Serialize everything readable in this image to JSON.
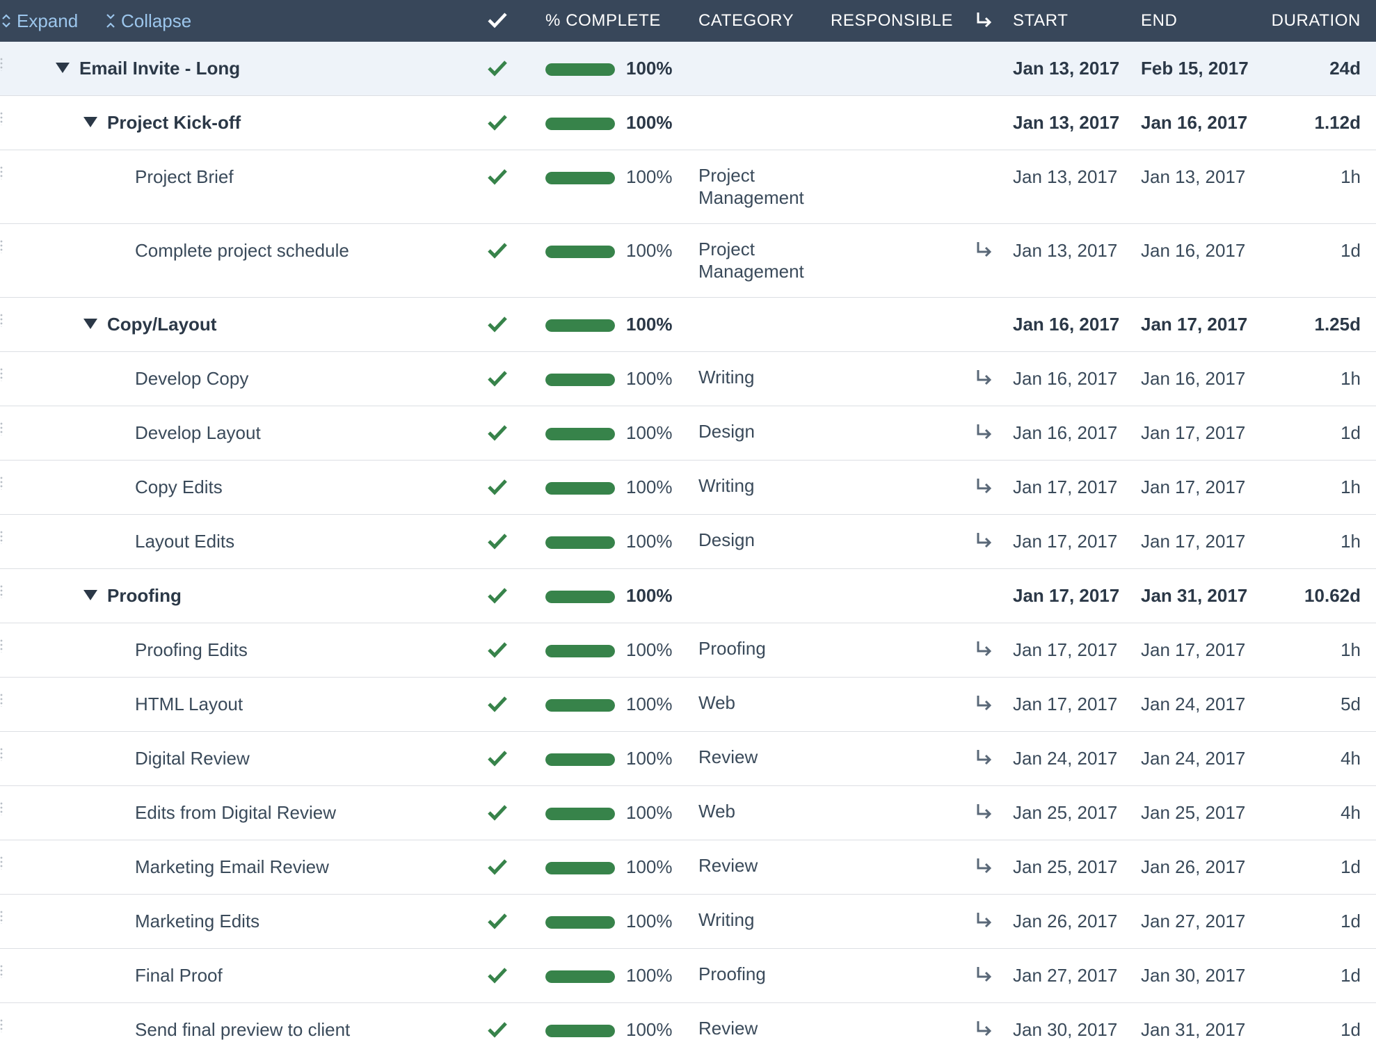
{
  "toolbar": {
    "expand_label": "Expand",
    "collapse_label": "Collapse"
  },
  "columns": {
    "pct": "% COMPLETE",
    "category": "CATEGORY",
    "responsible": "RESPONSIBLE",
    "start": "START",
    "end": "END",
    "duration": "DURATION"
  },
  "icons": {
    "check": "check-icon",
    "dependency": "dependency-arrow-icon",
    "collapse_toggle": "triangle-down-icon",
    "expand": "expand-icon",
    "collapse": "collapse-icon"
  },
  "colors": {
    "header_bg": "#38475a",
    "accent_link": "#9cc6ec",
    "complete_green": "#37834a",
    "group_bg": "#eef3f9"
  },
  "rows": [
    {
      "name": "Email Invite - Long",
      "level": 0,
      "percent": "100%",
      "progress": 1.0,
      "category": "",
      "dependency": false,
      "start": "Jan 13, 2017",
      "end": "Feb 15, 2017",
      "duration": "24d"
    },
    {
      "name": "Project Kick-off",
      "level": 1,
      "percent": "100%",
      "progress": 1.0,
      "category": "",
      "dependency": false,
      "start": "Jan 13, 2017",
      "end": "Jan 16, 2017",
      "duration": "1.12d"
    },
    {
      "name": "Project Brief",
      "level": 2,
      "percent": "100%",
      "progress": 1.0,
      "category": "Project Management",
      "dependency": false,
      "start": "Jan 13, 2017",
      "end": "Jan 13, 2017",
      "duration": "1h"
    },
    {
      "name": "Complete project schedule",
      "level": 2,
      "percent": "100%",
      "progress": 1.0,
      "category": "Project Management",
      "dependency": true,
      "start": "Jan 13, 2017",
      "end": "Jan 16, 2017",
      "duration": "1d"
    },
    {
      "name": "Copy/Layout",
      "level": 1,
      "percent": "100%",
      "progress": 1.0,
      "category": "",
      "dependency": false,
      "start": "Jan 16, 2017",
      "end": "Jan 17, 2017",
      "duration": "1.25d"
    },
    {
      "name": "Develop Copy",
      "level": 2,
      "percent": "100%",
      "progress": 1.0,
      "category": "Writing",
      "dependency": true,
      "start": "Jan 16, 2017",
      "end": "Jan 16, 2017",
      "duration": "1h"
    },
    {
      "name": "Develop Layout",
      "level": 2,
      "percent": "100%",
      "progress": 1.0,
      "category": "Design",
      "dependency": true,
      "start": "Jan 16, 2017",
      "end": "Jan 17, 2017",
      "duration": "1d"
    },
    {
      "name": "Copy Edits",
      "level": 2,
      "percent": "100%",
      "progress": 1.0,
      "category": "Writing",
      "dependency": true,
      "start": "Jan 17, 2017",
      "end": "Jan 17, 2017",
      "duration": "1h"
    },
    {
      "name": "Layout Edits",
      "level": 2,
      "percent": "100%",
      "progress": 1.0,
      "category": "Design",
      "dependency": true,
      "start": "Jan 17, 2017",
      "end": "Jan 17, 2017",
      "duration": "1h"
    },
    {
      "name": "Proofing",
      "level": 1,
      "percent": "100%",
      "progress": 1.0,
      "category": "",
      "dependency": false,
      "start": "Jan 17, 2017",
      "end": "Jan 31, 2017",
      "duration": "10.62d"
    },
    {
      "name": "Proofing Edits",
      "level": 2,
      "percent": "100%",
      "progress": 1.0,
      "category": "Proofing",
      "dependency": true,
      "start": "Jan 17, 2017",
      "end": "Jan 17, 2017",
      "duration": "1h"
    },
    {
      "name": "HTML Layout",
      "level": 2,
      "percent": "100%",
      "progress": 1.0,
      "category": "Web",
      "dependency": true,
      "start": "Jan 17, 2017",
      "end": "Jan 24, 2017",
      "duration": "5d"
    },
    {
      "name": "Digital Review",
      "level": 2,
      "percent": "100%",
      "progress": 1.0,
      "category": "Review",
      "dependency": true,
      "start": "Jan 24, 2017",
      "end": "Jan 24, 2017",
      "duration": "4h"
    },
    {
      "name": "Edits from Digital Review",
      "level": 2,
      "percent": "100%",
      "progress": 1.0,
      "category": "Web",
      "dependency": true,
      "start": "Jan 25, 2017",
      "end": "Jan 25, 2017",
      "duration": "4h"
    },
    {
      "name": "Marketing Email Review",
      "level": 2,
      "percent": "100%",
      "progress": 1.0,
      "category": "Review",
      "dependency": true,
      "start": "Jan 25, 2017",
      "end": "Jan 26, 2017",
      "duration": "1d"
    },
    {
      "name": "Marketing Edits",
      "level": 2,
      "percent": "100%",
      "progress": 1.0,
      "category": "Writing",
      "dependency": true,
      "start": "Jan 26, 2017",
      "end": "Jan 27, 2017",
      "duration": "1d"
    },
    {
      "name": "Final Proof",
      "level": 2,
      "percent": "100%",
      "progress": 1.0,
      "category": "Proofing",
      "dependency": true,
      "start": "Jan 27, 2017",
      "end": "Jan 30, 2017",
      "duration": "1d"
    },
    {
      "name": "Send final preview to client",
      "level": 2,
      "percent": "100%",
      "progress": 1.0,
      "category": "Review",
      "dependency": true,
      "start": "Jan 30, 2017",
      "end": "Jan 31, 2017",
      "duration": "1d"
    }
  ]
}
